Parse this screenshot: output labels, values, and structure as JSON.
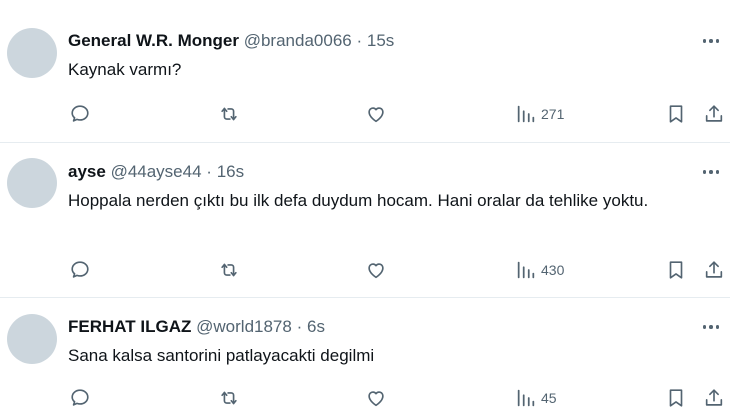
{
  "tweets": [
    {
      "name": "General W.R. Monger",
      "handle": "@branda0066",
      "separator": "·",
      "time": "15s",
      "text": "Kaynak varmı?",
      "views": "271"
    },
    {
      "name": "ayse",
      "handle": "@44ayse44",
      "separator": "·",
      "time": "16s",
      "text": "Hoppala nerden çıktı bu ilk defa duydum hocam. Hani oralar da tehlike yoktu.",
      "views": "430"
    },
    {
      "name": "FERHAT ILGAZ",
      "handle": "@world1878",
      "separator": "·",
      "time": "6s",
      "text": "Sana kalsa santorini patlayacakti degilmi",
      "views": "45"
    }
  ],
  "icons": {
    "reply": "reply-icon",
    "retweet": "retweet-icon",
    "like": "heart-icon",
    "views": "views-icon",
    "bookmark": "bookmark-icon",
    "share": "share-icon",
    "more": "more-icon"
  }
}
